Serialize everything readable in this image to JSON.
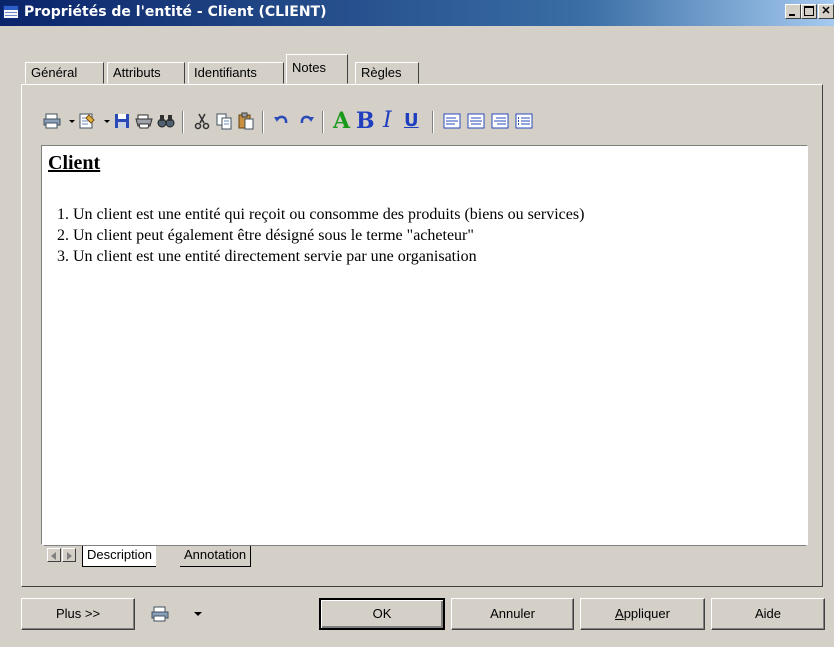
{
  "window": {
    "title": "Propriétés de l'entité - Client (CLIENT)"
  },
  "tabs": [
    "Général",
    "Attributs",
    "Identifiants",
    "Notes",
    "Règles"
  ],
  "active_tab": "Notes",
  "editor": {
    "heading": "Client",
    "lines": [
      "1. Un client est une entité qui reçoit ou consomme des produits (biens ou services)",
      "2. Un client peut également être désigné sous le terme \"acheteur\"",
      "3. Un client est une entité directement servie par une organisation"
    ]
  },
  "toolbar": {
    "color_letter": "A",
    "bold_letter": "B",
    "italic_letter": "I",
    "underline_letter": "U",
    "accent_green": "#1a9a1a",
    "accent_blue": "#1f3fbf"
  },
  "sheet_tabs": [
    "Description",
    "Annotation"
  ],
  "buttons": {
    "more": "Plus >>",
    "ok": "OK",
    "cancel": "Annuler",
    "apply_mnemonic": "A",
    "apply_rest": "ppliquer",
    "help": "Aide"
  }
}
